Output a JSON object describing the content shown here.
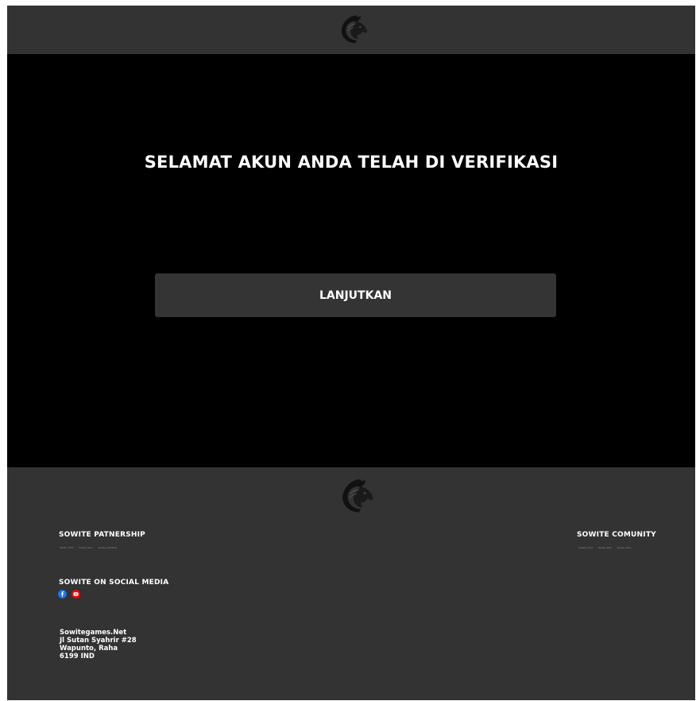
{
  "header": {
    "logo_icon": "horse-head-logo-icon"
  },
  "hero": {
    "title": "SELAMAT AKUN ANDA TELAH DI VERIFIKASI",
    "button_label": "LANJUTKAN"
  },
  "footer": {
    "logo_icon": "horse-head-logo-icon",
    "partnership": {
      "heading": "SOWITE PATNERSHIP",
      "links": [
        "Sowite_ThrR",
        "Sowite_Gum",
        "Sowite_CiffeShop"
      ]
    },
    "community": {
      "heading": "SOWITE COMUNITY",
      "links": [
        "Sowites_Tour",
        "Sowite_Mob",
        "Sowite_Team"
      ]
    },
    "social": {
      "heading": "SOWITE ON SOCIAL MEDIA",
      "icons": [
        "facebook-icon",
        "youtube-icon"
      ]
    },
    "address": {
      "line1": "Sowitegames.Net",
      "line2": "Jl Sutan Syahrir #28",
      "line3": "Wapunto, Raha",
      "line4": "6199 IND"
    }
  },
  "colors": {
    "page_bg": "#000000",
    "bar_bg": "#333333",
    "button_bg": "#343434",
    "text": "#ffffff",
    "facebook": "#1877f2",
    "youtube": "#ff0000"
  }
}
